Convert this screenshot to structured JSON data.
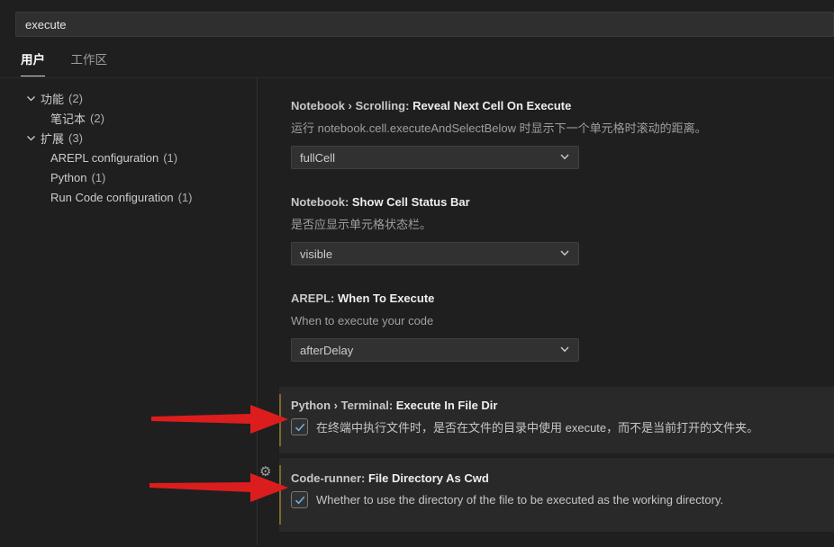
{
  "search": {
    "value": "execute"
  },
  "tabs": [
    {
      "label": "用户",
      "active": true
    },
    {
      "label": "工作区",
      "active": false
    }
  ],
  "tree": [
    {
      "label": "功能",
      "count": "(2)",
      "level": 0,
      "expanded": true
    },
    {
      "label": "笔记本",
      "count": "(2)",
      "level": 1
    },
    {
      "label": "扩展",
      "count": "(3)",
      "level": 0,
      "expanded": true
    },
    {
      "label": "AREPL configuration",
      "count": "(1)",
      "level": 1
    },
    {
      "label": "Python",
      "count": "(1)",
      "level": 1
    },
    {
      "label": "Run Code configuration",
      "count": "(1)",
      "level": 1
    }
  ],
  "settings": [
    {
      "type": "select",
      "prefix": "Notebook › Scrolling: ",
      "name": "Reveal Next Cell On Execute",
      "description": "运行 notebook.cell.executeAndSelectBelow 时显示下一个单元格时滚动的距离。",
      "value": "fullCell",
      "modified": false
    },
    {
      "type": "select",
      "prefix": "Notebook: ",
      "name": "Show Cell Status Bar",
      "description": "是否应显示单元格状态栏。",
      "value": "visible",
      "modified": false
    },
    {
      "type": "select",
      "prefix": "AREPL: ",
      "name": "When To Execute",
      "description": "When to execute your code",
      "value": "afterDelay",
      "modified": false
    },
    {
      "type": "checkbox",
      "prefix": "Python › Terminal: ",
      "name": "Execute In File Dir",
      "label": "在终端中执行文件时，是否在文件的目录中使用 execute，而不是当前打开的文件夹。",
      "checked": true,
      "modified": true,
      "highlighted": true
    },
    {
      "type": "checkbox",
      "prefix": "Code-runner: ",
      "name": "File Directory As Cwd",
      "label": "Whether to use the directory of the file to be executed as the working directory.",
      "checked": true,
      "modified": true,
      "highlighted": true,
      "gear_icon": true
    }
  ],
  "colors": {
    "page_bg": "#1f1f1f",
    "input_bg": "#2f2f2f",
    "row_highlight_bg": "#292929",
    "modified_indicator": "#7d672c",
    "checkbox_check": "#6fb3e8",
    "annotation_arrow": "#dc1d1d",
    "active_tab_underline": "#dcdcdc"
  }
}
